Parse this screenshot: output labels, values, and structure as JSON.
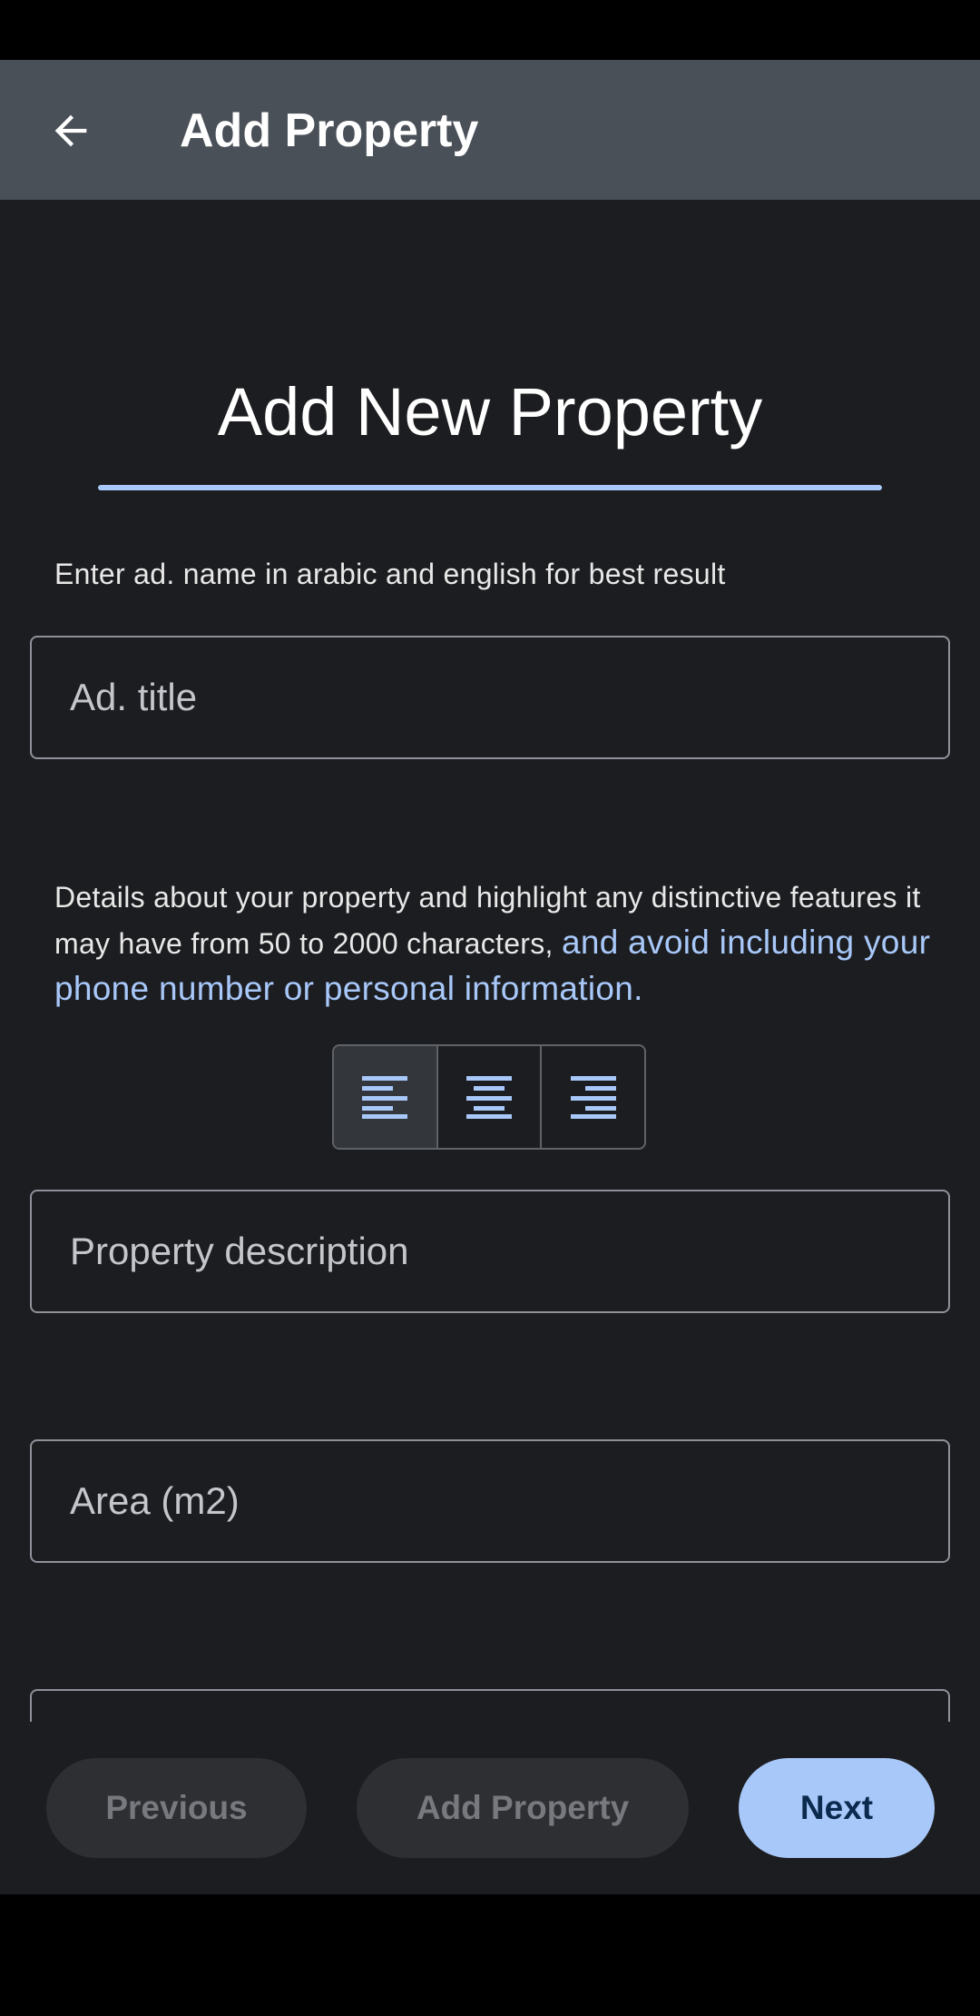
{
  "app_bar": {
    "title": "Add Property",
    "back_icon": "arrow-back-icon"
  },
  "form": {
    "heading": "Add New Property",
    "title_hint": "Enter ad. name in arabic and english for best result",
    "title_placeholder": "Ad. title",
    "description_hint": "Details about your property and highlight any distinctive features it may have from 50 to 2000 characters, ",
    "description_hint_accent": "and avoid including your phone number or personal information.",
    "alignment_buttons": [
      {
        "icon": "align-left-icon",
        "selected": true
      },
      {
        "icon": "align-center-icon",
        "selected": false
      },
      {
        "icon": "align-right-icon",
        "selected": false
      }
    ],
    "description_placeholder": "Property description",
    "area_placeholder": "Area (m2)"
  },
  "footer": {
    "previous_label": "Previous",
    "add_property_label": "Add Property",
    "next_label": "Next"
  },
  "colors": {
    "accent": "#a8c8fa",
    "app_bar": "#4a5058",
    "background": "#1c1d20",
    "disabled_button": "#2e2f33"
  }
}
